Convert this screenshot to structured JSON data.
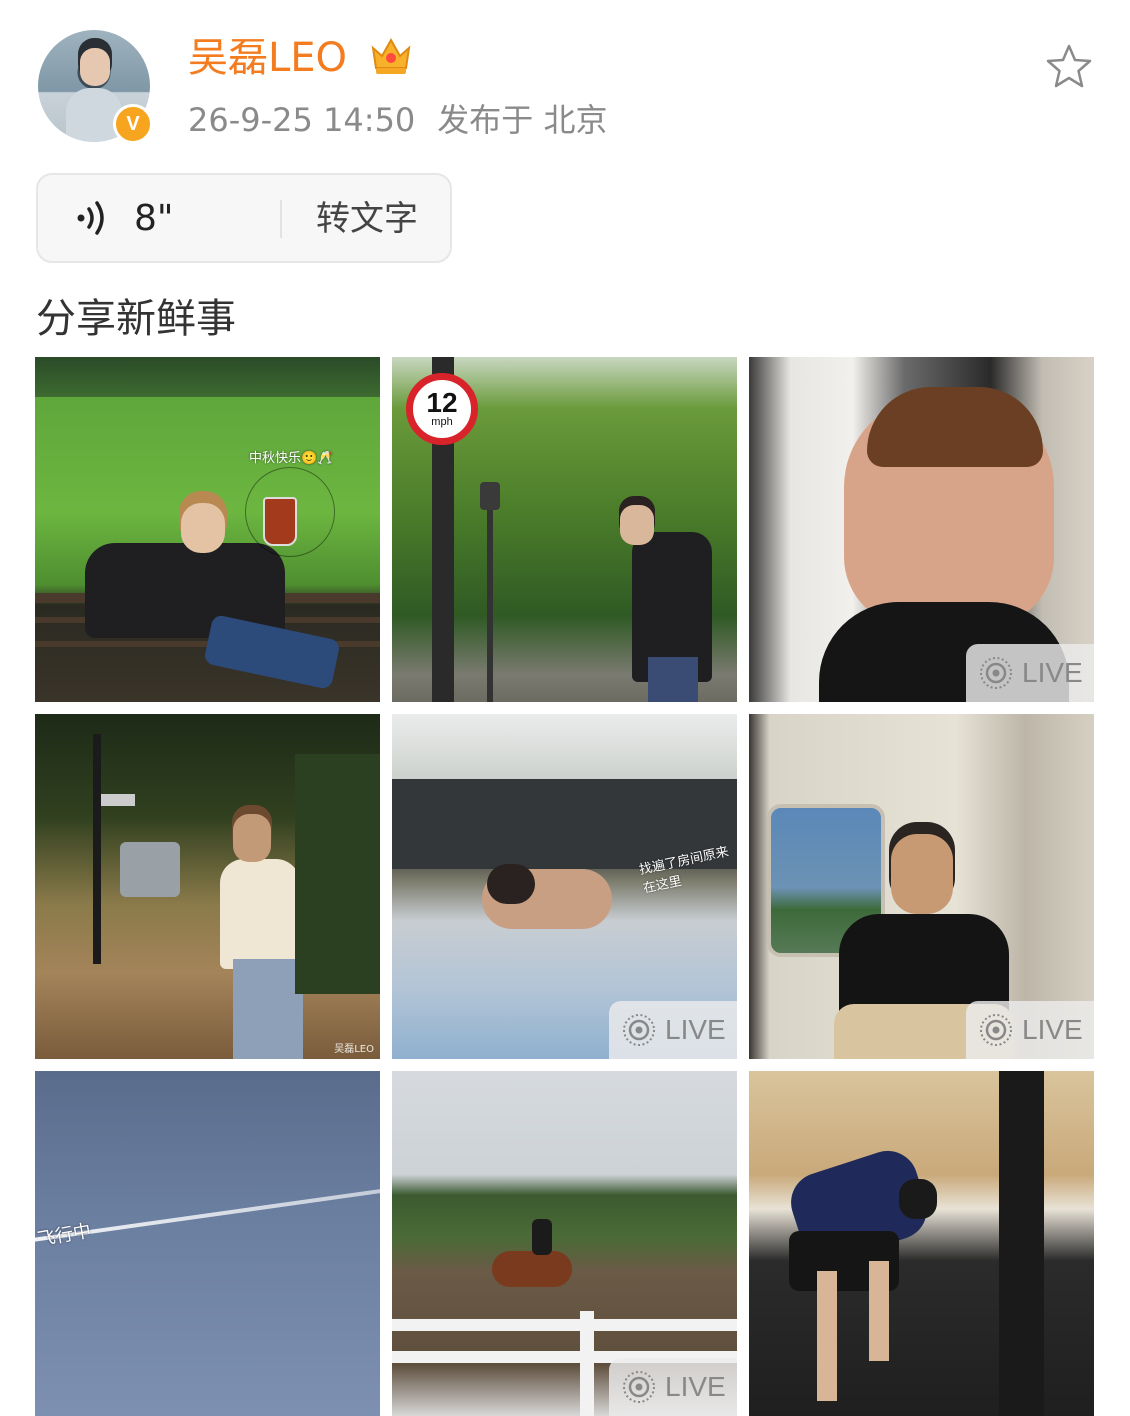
{
  "post": {
    "author": "吴磊LEO",
    "timestamp": "26-9-25 14:50",
    "location": "发布于 北京",
    "text": "分享新鲜事"
  },
  "voice": {
    "duration": "8\"",
    "to_text_label": "转文字"
  },
  "photos": [
    {
      "overlay_text": "中秋快乐🙂🥂",
      "watermark": "",
      "live": ""
    },
    {
      "overlay_text": "",
      "sign_top": "12",
      "sign_bottom": "mph",
      "live": ""
    },
    {
      "overlay_text": "",
      "live": "LIVE"
    },
    {
      "overlay_text": "",
      "watermark": "吴磊LEO",
      "live": ""
    },
    {
      "overlay_text": "找遍了房间原来在这里",
      "live": "LIVE"
    },
    {
      "overlay_text": "",
      "live": "LIVE"
    },
    {
      "overlay_text": "飞行中",
      "live": ""
    },
    {
      "overlay_text": "",
      "live": "LIVE"
    },
    {
      "overlay_text": "",
      "live": ""
    }
  ],
  "colors": {
    "name": "#f47c20",
    "meta": "#8a8a8a",
    "badge": "#f7a51e"
  },
  "icons": [
    "crown-icon",
    "verified-badge-icon",
    "star-icon",
    "voice-wave-icon",
    "live-photo-icon"
  ]
}
